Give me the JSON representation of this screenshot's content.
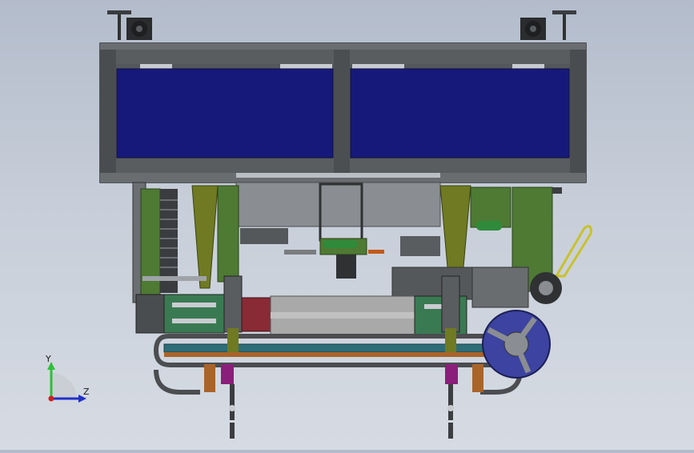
{
  "viewport": {
    "background_top": "#b3bccb",
    "background_bottom": "#d6dbe3"
  },
  "model": {
    "frame_color": "#4c4f52",
    "panel_color": "#16197a",
    "green_color": "#4e7a34",
    "olive_color": "#6f7a22",
    "slide_color": "#a9a9a9",
    "rail_color": "#2e6d78",
    "wheel_color": "#3c43a0",
    "handle_color": "#c9c22a",
    "accent_red": "#8a2a35",
    "accent_magenta": "#8b1e7a"
  },
  "triad": {
    "y_label": "Y",
    "z_label": "Z",
    "y_axis_color": "#2fbf3a",
    "z_axis_color": "#2131c8",
    "origin_color": "#d02020"
  }
}
